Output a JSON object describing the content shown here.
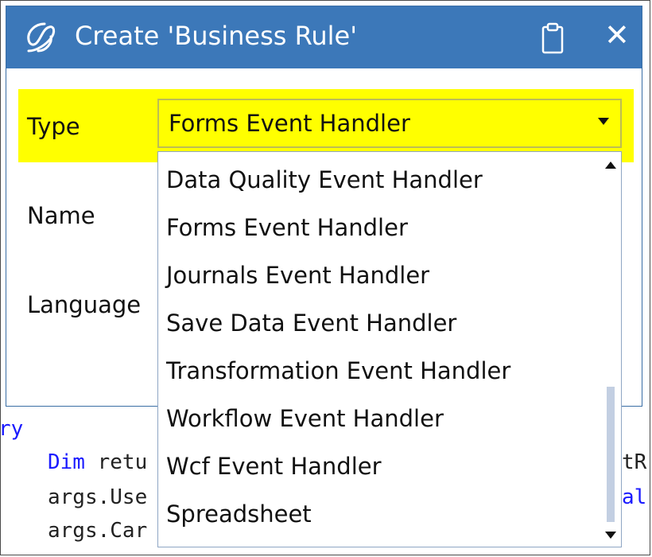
{
  "dialog": {
    "title": "Create 'Business Rule'",
    "fields": {
      "type_label": "Type",
      "name_label": "Name",
      "language_label": "Language"
    },
    "type_select": {
      "selected": "Forms Event Handler",
      "options": [
        "Data Quality Event Handler",
        "Forms Event Handler",
        "Journals Event Handler",
        "Save Data Event Handler",
        "Transformation Event Handler",
        "Workflow Event Handler",
        "Wcf Event Handler",
        "Spreadsheet"
      ]
    }
  },
  "code": {
    "line1": "ry",
    "line2_kw": "Dim",
    "line2_rest": " retu",
    "line2_tail": "tR",
    "line3": "args.Use",
    "line3_tail": "al",
    "line4": "args.Car"
  },
  "colors": {
    "titlebar": "#3c78b9",
    "highlight": "#ffff00",
    "keyword": "#1a1aff"
  },
  "icons": {
    "logo": "app-logo-icon",
    "clipboard": "clipboard-icon",
    "close": "close-icon",
    "dropdown": "chevron-down-icon"
  }
}
